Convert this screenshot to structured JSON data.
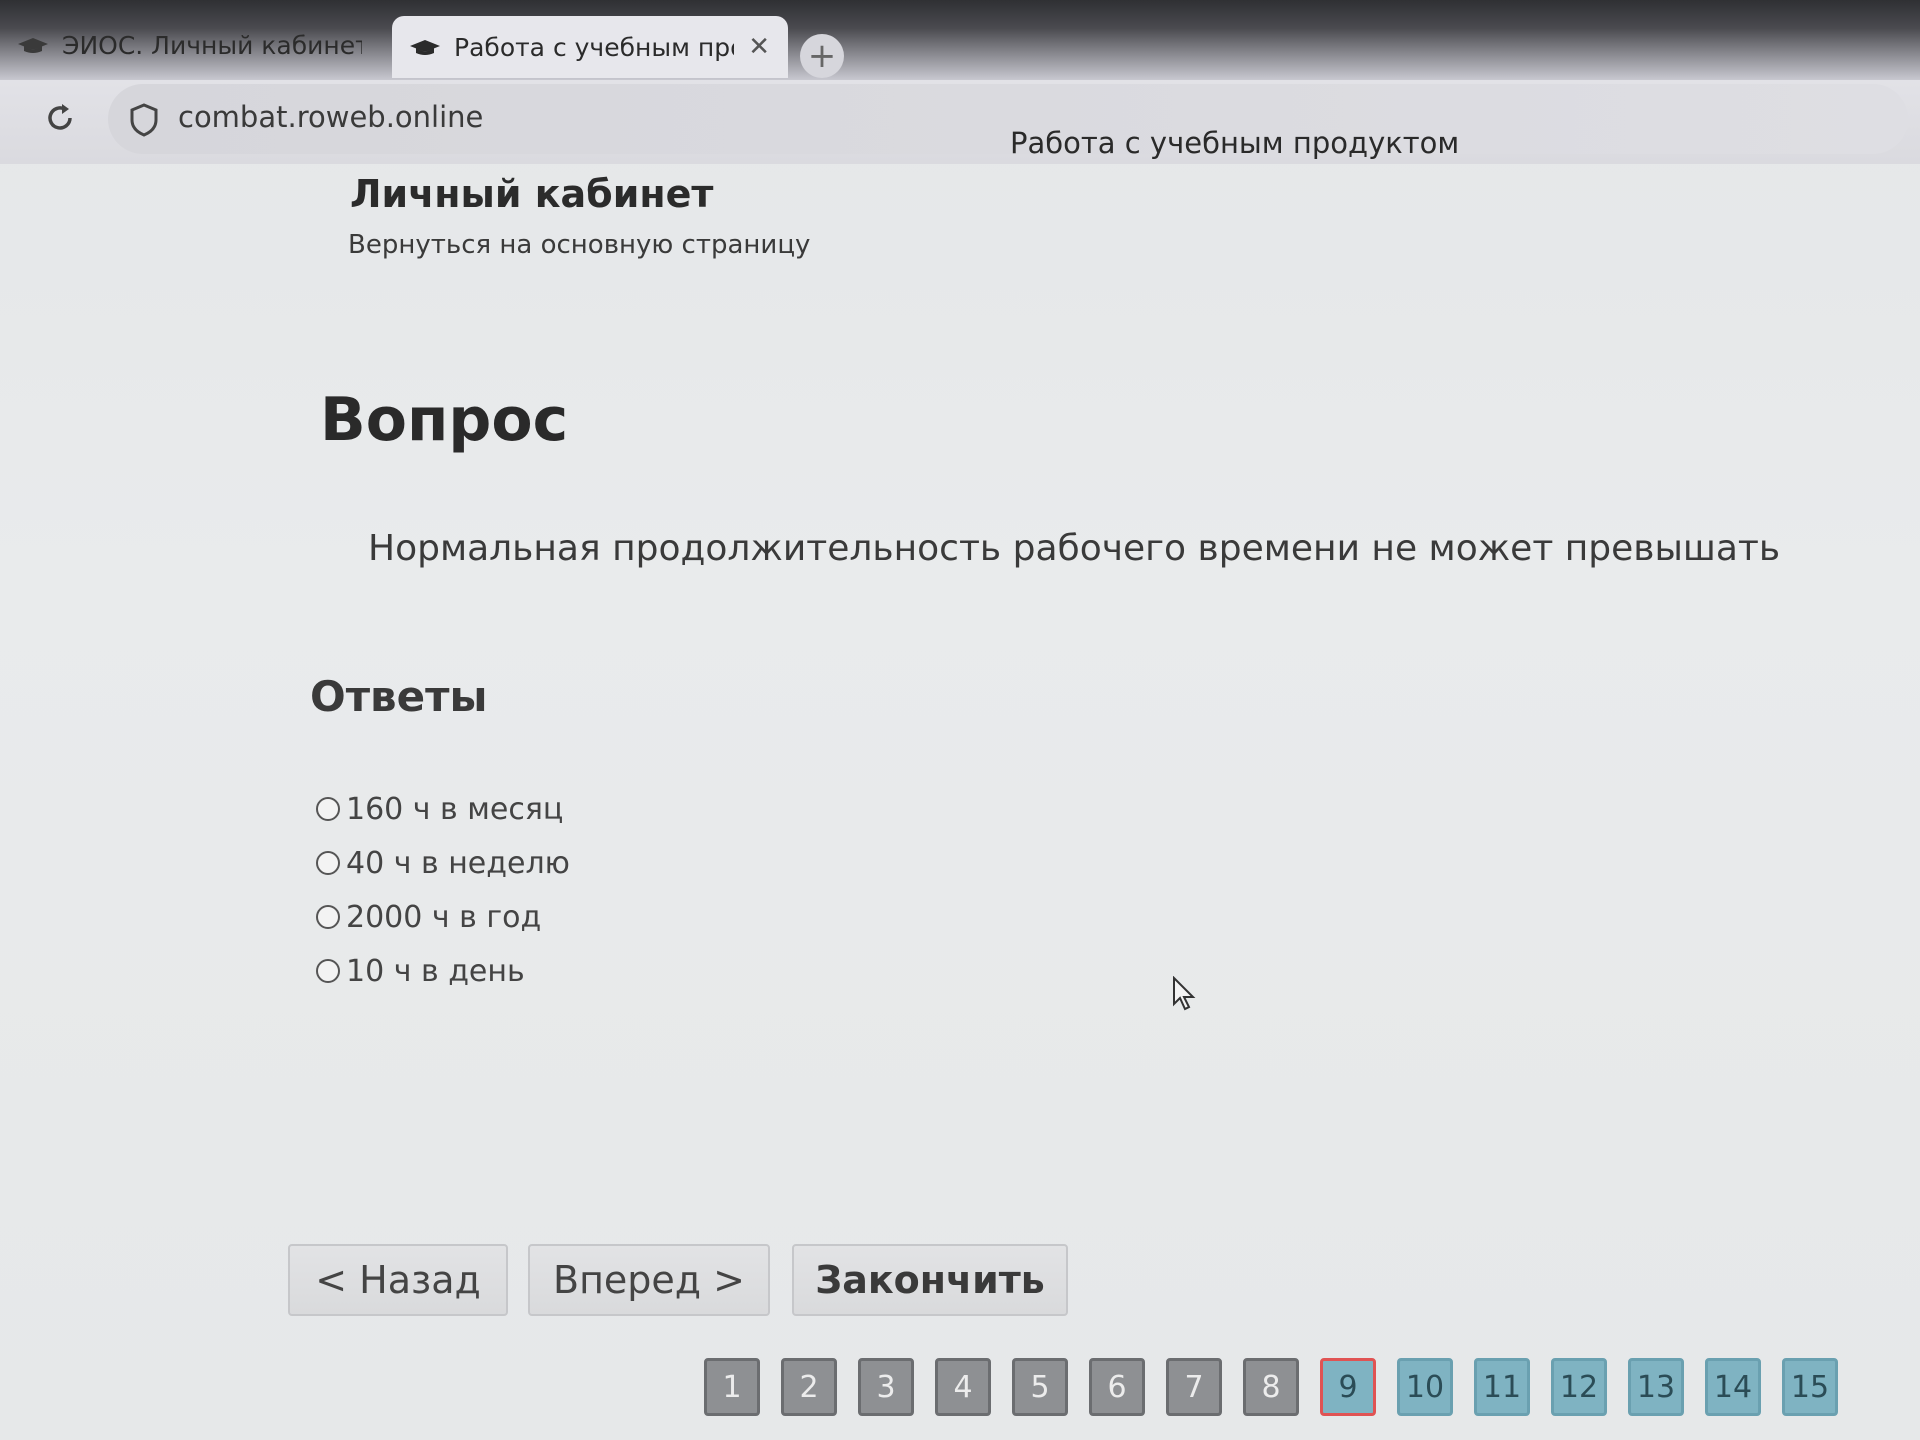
{
  "browser": {
    "tabs": [
      {
        "title": "ЭИОС. Личный кабинет",
        "active": false
      },
      {
        "title": "Работа с учебным про",
        "active": true
      }
    ],
    "new_tab_label": "+",
    "close_label": "✕",
    "url": "combat.roweb.online",
    "page_title": "Работа с учебным продуктом"
  },
  "header": {
    "site_title": "Личный кабинет",
    "back_link": "Вернуться на основную страницу"
  },
  "question": {
    "heading": "Вопрос",
    "text": "Нормальная продолжительность рабочего времени не может превышать"
  },
  "answers": {
    "heading": "Ответы",
    "options": [
      {
        "label": "160 ч в месяц"
      },
      {
        "label": "40 ч в неделю"
      },
      {
        "label": "2000 ч в год"
      },
      {
        "label": "10 ч в день"
      }
    ]
  },
  "buttons": {
    "back": "< Назад",
    "next": "Вперед >",
    "finish": "Закончить"
  },
  "pagination": {
    "current": 9,
    "pages": [
      "1",
      "2",
      "3",
      "4",
      "5",
      "6",
      "7",
      "8",
      "9",
      "10",
      "11",
      "12",
      "13",
      "14",
      "15"
    ]
  },
  "colors": {
    "page_done": "#8e9093",
    "page_todo": "#7fb3c2",
    "page_current_border": "#e05353"
  }
}
